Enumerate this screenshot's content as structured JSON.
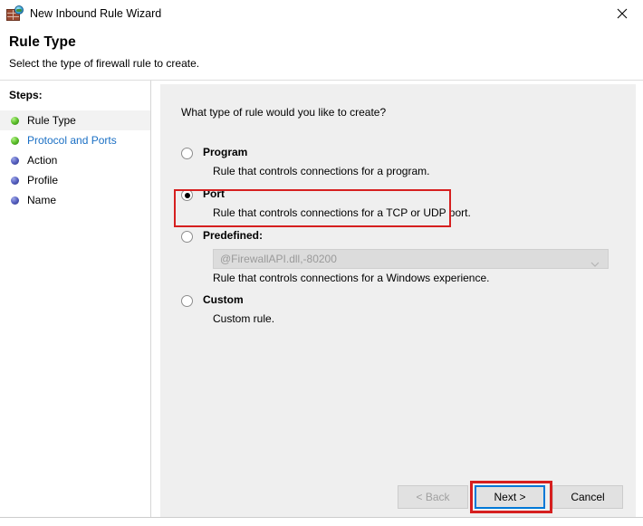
{
  "window": {
    "title": "New Inbound Rule Wizard",
    "icon": "firewall-globe-icon",
    "close_label": "✕"
  },
  "header": {
    "title": "Rule Type",
    "subtitle": "Select the type of firewall rule to create."
  },
  "sidebar": {
    "label": "Steps:",
    "items": [
      {
        "label": "Rule Type",
        "bullet": "green",
        "state": "current"
      },
      {
        "label": "Protocol and Ports",
        "bullet": "green",
        "state": "link"
      },
      {
        "label": "Action",
        "bullet": "blue",
        "state": "pending"
      },
      {
        "label": "Profile",
        "bullet": "blue",
        "state": "pending"
      },
      {
        "label": "Name",
        "bullet": "blue",
        "state": "pending"
      }
    ]
  },
  "main": {
    "question": "What type of rule would you like to create?",
    "options": [
      {
        "label": "Program",
        "description": "Rule that controls connections for a program.",
        "selected": false
      },
      {
        "label": "Port",
        "description": "Rule that controls connections for a TCP or UDP port.",
        "selected": true,
        "highlighted": true
      },
      {
        "label": "Predefined:",
        "description": "Rule that controls connections for a Windows experience.",
        "selected": false,
        "dropdown_value": "@FirewallAPI.dll,-80200",
        "dropdown_disabled": true
      },
      {
        "label": "Custom",
        "description": "Custom rule.",
        "selected": false
      }
    ]
  },
  "footer": {
    "back_label": "< Back",
    "next_label": "Next >",
    "cancel_label": "Cancel"
  },
  "colors": {
    "annotation": "#d61f1f",
    "focus": "#0078d7",
    "link": "#1a6fc4",
    "panel": "#efefef"
  }
}
